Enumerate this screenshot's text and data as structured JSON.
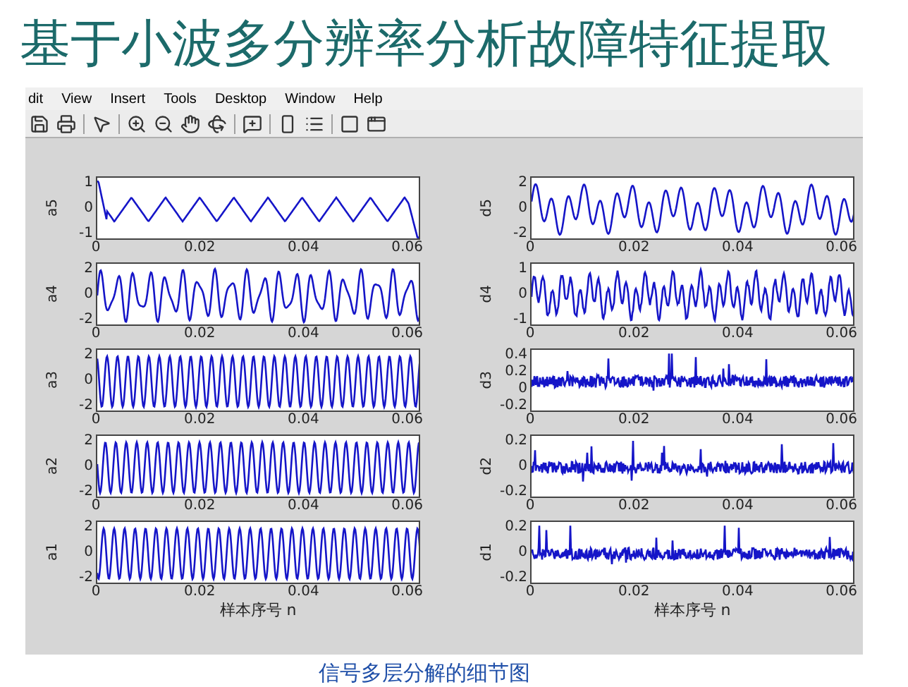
{
  "title": "基于小波多分辨率分析故障特征提取",
  "figure_window": {
    "menu": [
      "dit",
      "View",
      "Insert",
      "Tools",
      "Desktop",
      "Window",
      "Help"
    ],
    "columns": [
      {
        "xlabel": "样本序号 n",
        "plots": [
          {
            "label": "a5",
            "yticks": [
              "1",
              "0",
              "-1"
            ],
            "xticks": [
              "0",
              "0.02",
              "0.04",
              "0.06"
            ]
          },
          {
            "label": "a4",
            "yticks": [
              "2",
              "0",
              "-2"
            ],
            "xticks": [
              "0",
              "0.02",
              "0.04",
              "0.06"
            ]
          },
          {
            "label": "a3",
            "yticks": [
              "2",
              "0",
              "-2"
            ],
            "xticks": [
              "0",
              "0.02",
              "0.04",
              "0.06"
            ]
          },
          {
            "label": "a2",
            "yticks": [
              "2",
              "0",
              "-2"
            ],
            "xticks": [
              "0",
              "0.02",
              "0.04",
              "0.06"
            ]
          },
          {
            "label": "a1",
            "yticks": [
              "2",
              "0",
              "-2"
            ],
            "xticks": [
              "0",
              "0.02",
              "0.04",
              "0.06"
            ]
          }
        ]
      },
      {
        "xlabel": "样本序号 n",
        "plots": [
          {
            "label": "d5",
            "yticks": [
              "2",
              "0",
              "-2"
            ],
            "xticks": [
              "0",
              "0.02",
              "0.04",
              "0.06"
            ]
          },
          {
            "label": "d4",
            "yticks": [
              "1",
              "0",
              "-1"
            ],
            "xticks": [
              "0",
              "0.02",
              "0.04",
              "0.06"
            ]
          },
          {
            "label": "d3",
            "yticks": [
              "0.4",
              "0.2",
              "0",
              "-0.2"
            ],
            "xticks": [
              "0",
              "0.02",
              "0.04",
              "0.06"
            ]
          },
          {
            "label": "d2",
            "yticks": [
              "0.2",
              "0",
              "-0.2"
            ],
            "xticks": [
              "0",
              "0.02",
              "0.04",
              "0.06"
            ]
          },
          {
            "label": "d1",
            "yticks": [
              "0.2",
              "0",
              "-0.2"
            ],
            "xticks": [
              "0",
              "0.02",
              "0.04",
              "0.06"
            ]
          }
        ]
      }
    ]
  },
  "caption": "信号多层分解的细节图"
}
